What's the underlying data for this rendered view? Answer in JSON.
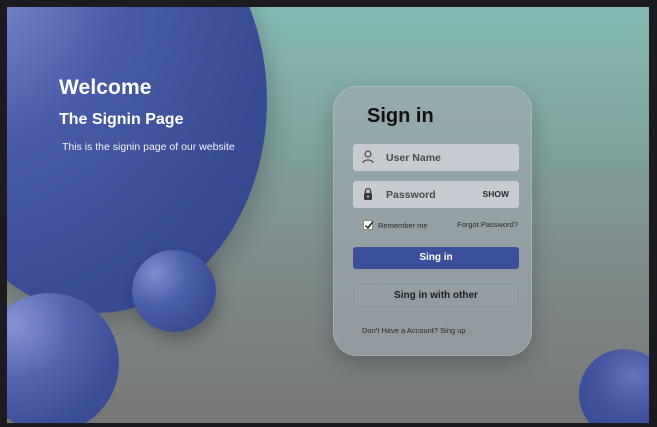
{
  "hero": {
    "title": "Welcome",
    "subtitle": "The Signin Page",
    "description": "This is the signin page of our website"
  },
  "signin": {
    "title": "Sign in",
    "username": {
      "placeholder": "User Name",
      "value": "",
      "icon": "user-icon"
    },
    "password": {
      "placeholder": "Password",
      "value": "",
      "icon": "lock-icon",
      "toggle_label": "SHOW"
    },
    "remember_label": "Remember me",
    "remember_checked": true,
    "forgot_label": "Forgot Password?",
    "primary_button": "Sing in",
    "secondary_button": "Sing in with other",
    "signup_text": "Don't Have a Account? Sing up"
  },
  "colors": {
    "accent": "#3b4f9a",
    "blob": "#3a4d95",
    "background_top": "#86bab4",
    "background_bottom": "#767676"
  }
}
